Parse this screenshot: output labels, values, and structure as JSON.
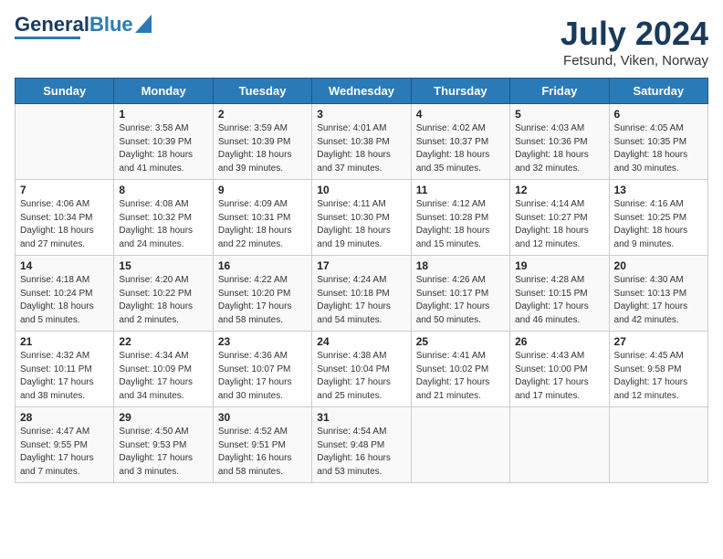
{
  "header": {
    "logo_general": "General",
    "logo_blue": "Blue",
    "month": "July 2024",
    "location": "Fetsund, Viken, Norway"
  },
  "weekdays": [
    "Sunday",
    "Monday",
    "Tuesday",
    "Wednesday",
    "Thursday",
    "Friday",
    "Saturday"
  ],
  "weeks": [
    [
      {
        "day": "",
        "info": ""
      },
      {
        "day": "1",
        "info": "Sunrise: 3:58 AM\nSunset: 10:39 PM\nDaylight: 18 hours\nand 41 minutes."
      },
      {
        "day": "2",
        "info": "Sunrise: 3:59 AM\nSunset: 10:39 PM\nDaylight: 18 hours\nand 39 minutes."
      },
      {
        "day": "3",
        "info": "Sunrise: 4:01 AM\nSunset: 10:38 PM\nDaylight: 18 hours\nand 37 minutes."
      },
      {
        "day": "4",
        "info": "Sunrise: 4:02 AM\nSunset: 10:37 PM\nDaylight: 18 hours\nand 35 minutes."
      },
      {
        "day": "5",
        "info": "Sunrise: 4:03 AM\nSunset: 10:36 PM\nDaylight: 18 hours\nand 32 minutes."
      },
      {
        "day": "6",
        "info": "Sunrise: 4:05 AM\nSunset: 10:35 PM\nDaylight: 18 hours\nand 30 minutes."
      }
    ],
    [
      {
        "day": "7",
        "info": "Sunrise: 4:06 AM\nSunset: 10:34 PM\nDaylight: 18 hours\nand 27 minutes."
      },
      {
        "day": "8",
        "info": "Sunrise: 4:08 AM\nSunset: 10:32 PM\nDaylight: 18 hours\nand 24 minutes."
      },
      {
        "day": "9",
        "info": "Sunrise: 4:09 AM\nSunset: 10:31 PM\nDaylight: 18 hours\nand 22 minutes."
      },
      {
        "day": "10",
        "info": "Sunrise: 4:11 AM\nSunset: 10:30 PM\nDaylight: 18 hours\nand 19 minutes."
      },
      {
        "day": "11",
        "info": "Sunrise: 4:12 AM\nSunset: 10:28 PM\nDaylight: 18 hours\nand 15 minutes."
      },
      {
        "day": "12",
        "info": "Sunrise: 4:14 AM\nSunset: 10:27 PM\nDaylight: 18 hours\nand 12 minutes."
      },
      {
        "day": "13",
        "info": "Sunrise: 4:16 AM\nSunset: 10:25 PM\nDaylight: 18 hours\nand 9 minutes."
      }
    ],
    [
      {
        "day": "14",
        "info": "Sunrise: 4:18 AM\nSunset: 10:24 PM\nDaylight: 18 hours\nand 5 minutes."
      },
      {
        "day": "15",
        "info": "Sunrise: 4:20 AM\nSunset: 10:22 PM\nDaylight: 18 hours\nand 2 minutes."
      },
      {
        "day": "16",
        "info": "Sunrise: 4:22 AM\nSunset: 10:20 PM\nDaylight: 17 hours\nand 58 minutes."
      },
      {
        "day": "17",
        "info": "Sunrise: 4:24 AM\nSunset: 10:18 PM\nDaylight: 17 hours\nand 54 minutes."
      },
      {
        "day": "18",
        "info": "Sunrise: 4:26 AM\nSunset: 10:17 PM\nDaylight: 17 hours\nand 50 minutes."
      },
      {
        "day": "19",
        "info": "Sunrise: 4:28 AM\nSunset: 10:15 PM\nDaylight: 17 hours\nand 46 minutes."
      },
      {
        "day": "20",
        "info": "Sunrise: 4:30 AM\nSunset: 10:13 PM\nDaylight: 17 hours\nand 42 minutes."
      }
    ],
    [
      {
        "day": "21",
        "info": "Sunrise: 4:32 AM\nSunset: 10:11 PM\nDaylight: 17 hours\nand 38 minutes."
      },
      {
        "day": "22",
        "info": "Sunrise: 4:34 AM\nSunset: 10:09 PM\nDaylight: 17 hours\nand 34 minutes."
      },
      {
        "day": "23",
        "info": "Sunrise: 4:36 AM\nSunset: 10:07 PM\nDaylight: 17 hours\nand 30 minutes."
      },
      {
        "day": "24",
        "info": "Sunrise: 4:38 AM\nSunset: 10:04 PM\nDaylight: 17 hours\nand 25 minutes."
      },
      {
        "day": "25",
        "info": "Sunrise: 4:41 AM\nSunset: 10:02 PM\nDaylight: 17 hours\nand 21 minutes."
      },
      {
        "day": "26",
        "info": "Sunrise: 4:43 AM\nSunset: 10:00 PM\nDaylight: 17 hours\nand 17 minutes."
      },
      {
        "day": "27",
        "info": "Sunrise: 4:45 AM\nSunset: 9:58 PM\nDaylight: 17 hours\nand 12 minutes."
      }
    ],
    [
      {
        "day": "28",
        "info": "Sunrise: 4:47 AM\nSunset: 9:55 PM\nDaylight: 17 hours\nand 7 minutes."
      },
      {
        "day": "29",
        "info": "Sunrise: 4:50 AM\nSunset: 9:53 PM\nDaylight: 17 hours\nand 3 minutes."
      },
      {
        "day": "30",
        "info": "Sunrise: 4:52 AM\nSunset: 9:51 PM\nDaylight: 16 hours\nand 58 minutes."
      },
      {
        "day": "31",
        "info": "Sunrise: 4:54 AM\nSunset: 9:48 PM\nDaylight: 16 hours\nand 53 minutes."
      },
      {
        "day": "",
        "info": ""
      },
      {
        "day": "",
        "info": ""
      },
      {
        "day": "",
        "info": ""
      }
    ]
  ]
}
